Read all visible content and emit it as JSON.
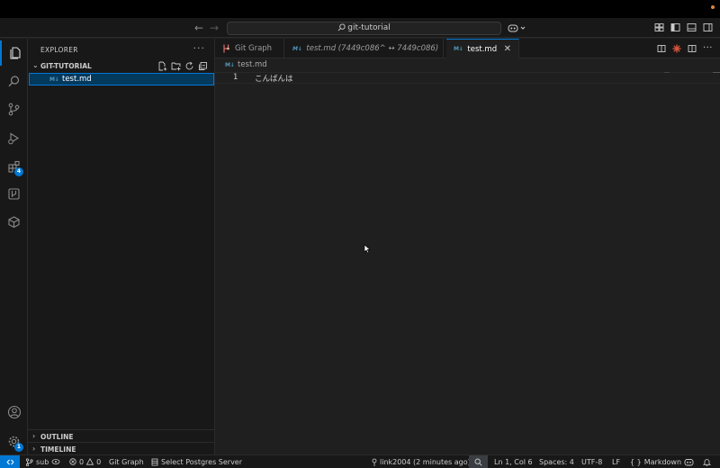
{
  "titlebar": {
    "search_text": "git-tutorial"
  },
  "activity_bar": {
    "items": [
      "explorer-icon",
      "search-icon",
      "source-control-icon",
      "run-debug-icon",
      "extensions-icon",
      "git-graph-icon",
      "database-icon"
    ],
    "extensions_badge": "4",
    "settings_badge": "1",
    "accent_color": "#0078d4"
  },
  "sidebar": {
    "title": "EXPLORER",
    "more": "···",
    "folder": "GIT-TUTORIAL",
    "files": [
      {
        "badge": "M↓",
        "name": "test.md"
      }
    ],
    "outline": "OUTLINE",
    "timeline": "TIMELINE"
  },
  "tabs": [
    {
      "label": "Git Graph"
    },
    {
      "badge": "M↓",
      "label": "test.md (7449c086^ ↔ 7449c086)"
    },
    {
      "badge": "M↓",
      "label": "test.md",
      "close": "✕"
    }
  ],
  "breadcrumbs": {
    "badge": "M↓",
    "file": "test.md"
  },
  "editor": {
    "line_number": "1",
    "line_text": "こんばんは"
  },
  "statusbar": {
    "branch": "sub",
    "errors": "0",
    "warnings": "0",
    "git_graph": "Git Graph",
    "postgres": "Select Postgres Server",
    "blame": "link2004 (2 minutes ago)",
    "position": "Ln 1, Col 6",
    "spaces": "Spaces: 4",
    "encoding": "UTF-8",
    "eol": "LF",
    "language": "Markdown"
  }
}
